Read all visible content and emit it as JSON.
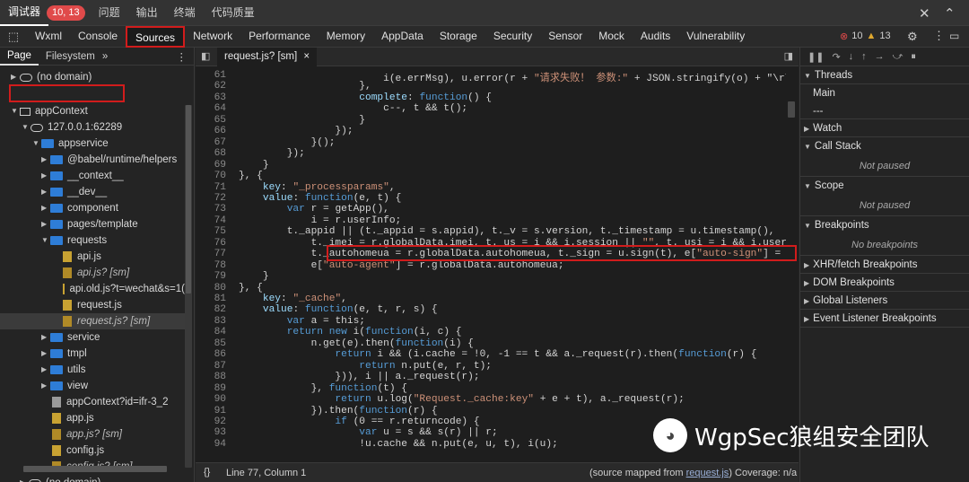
{
  "topbar": {
    "tabs": [
      "调试器",
      "问题",
      "输出",
      "终端",
      "代码质量"
    ],
    "badge": "10, 13"
  },
  "devtabs": [
    "Wxml",
    "Console",
    "Sources",
    "Network",
    "Performance",
    "Memory",
    "AppData",
    "Storage",
    "Security",
    "Sensor",
    "Mock",
    "Audits",
    "Vulnerability"
  ],
  "counts": {
    "errors": "10",
    "warnings": "13"
  },
  "left": {
    "tabs": [
      "Page",
      "Filesystem"
    ],
    "tree": [
      "(no domain)",
      "appContext",
      "127.0.0.1:62289",
      "appservice",
      "@babel/runtime/helpers",
      "__context__",
      "__dev__",
      "component",
      "pages/template",
      "requests",
      "api.js",
      "api.js? [sm]",
      "api.old.js?t=wechat&s=1(",
      "request.js",
      "request.js? [sm]",
      "service",
      "tmpl",
      "utils",
      "view",
      "appContext?id=ifr-3_2",
      "app.js",
      "app.js? [sm]",
      "config.js",
      "config.js? [sm]",
      "(no domain)"
    ]
  },
  "editor": {
    "file_tab": "request.js? [sm]",
    "lines": [
      {
        "n": "61",
        "t": "                        i(e.errMsg), u.error(r + \"请求失败！ 参数:\" + JSON.stringify(o) + \"\\r\\"
      },
      {
        "n": "62",
        "t": "                    },"
      },
      {
        "n": "63",
        "t": "                    complete: function() {"
      },
      {
        "n": "64",
        "t": "                        c--, t && t();"
      },
      {
        "n": "65",
        "t": "                    }"
      },
      {
        "n": "66",
        "t": "                });"
      },
      {
        "n": "67",
        "t": "            }();"
      },
      {
        "n": "68",
        "t": "        });"
      },
      {
        "n": "69",
        "t": "    }"
      },
      {
        "n": "70",
        "t": "}, {"
      },
      {
        "n": "71",
        "t": "    key: \"_processparams\","
      },
      {
        "n": "72",
        "t": "    value: function(e, t) {"
      },
      {
        "n": "73",
        "t": "        var r = getApp(),"
      },
      {
        "n": "74",
        "t": "            i = r.userInfo;"
      },
      {
        "n": "75",
        "t": "        t._appid || (t._appid = s.appid), t._v = s.version, t._timestamp = u.timestamp(),"
      },
      {
        "n": "76",
        "t": "            t._imei = r.globalData.imei, t._us = i && i.session || \"\", t._usi = i && i.userid ||"
      },
      {
        "n": "77",
        "t": "            t._autohomeua = r.globalData.autohomeua, t._sign = u.sign(t), e[\"auto-sign\"] = t._sig"
      },
      {
        "n": "78",
        "t": "            e[\"auto-agent\"] = r.globalData.autohomeua;"
      },
      {
        "n": "79",
        "t": "    }"
      },
      {
        "n": "80",
        "t": "}, {"
      },
      {
        "n": "81",
        "t": "    key: \"_cache\","
      },
      {
        "n": "82",
        "t": "    value: function(e, t, r, s) {"
      },
      {
        "n": "83",
        "t": "        var a = this;"
      },
      {
        "n": "84",
        "t": "        return new i(function(i, c) {"
      },
      {
        "n": "85",
        "t": "            n.get(e).then(function(i) {"
      },
      {
        "n": "86",
        "t": "                return i && (i.cache = !0, -1 == t && a._request(r).then(function(r) {"
      },
      {
        "n": "87",
        "t": "                    return n.put(e, r, t);"
      },
      {
        "n": "88",
        "t": "                })), i || a._request(r);"
      },
      {
        "n": "89",
        "t": "            }, function(t) {"
      },
      {
        "n": "90",
        "t": "                return u.log(\"Request._cache:key\" + e + t), a._request(r);"
      },
      {
        "n": "91",
        "t": "            }).then(function(r) {"
      },
      {
        "n": "92",
        "t": "                if (0 == r.returncode) {"
      },
      {
        "n": "93",
        "t": "                    var u = s && s(r) || r;"
      },
      {
        "n": "94",
        "t": "                    !u.cache && n.put(e, u, t), i(u);"
      }
    ],
    "status_left": "Line 77, Column 1",
    "status_right_pre": "(source mapped from ",
    "status_link": "request.js",
    "status_right_post": ") Coverage: n/a"
  },
  "right": {
    "sections": [
      "Threads",
      "Main",
      "---",
      "Watch",
      "Call Stack",
      "Not paused",
      "Scope",
      "Not paused",
      "Breakpoints",
      "No breakpoints",
      "XHR/fetch Breakpoints",
      "DOM Breakpoints",
      "Global Listeners",
      "Event Listener Breakpoints"
    ]
  },
  "watermark": "WgpSec狼组安全团队"
}
